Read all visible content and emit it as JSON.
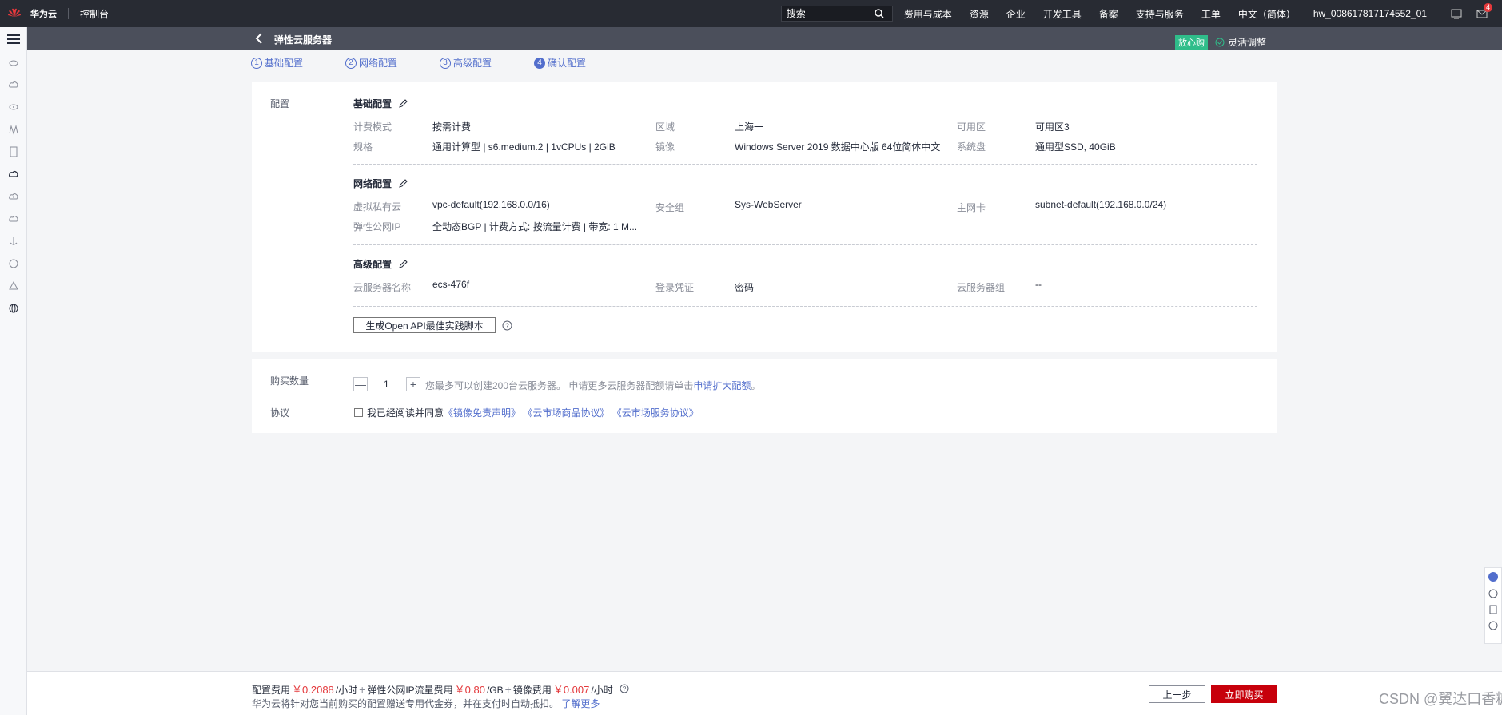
{
  "topbar": {
    "brand": "华为云",
    "console": "控制台",
    "search_placeholder": "搜索",
    "nav": [
      "费用与成本",
      "资源",
      "企业",
      "开发工具",
      "备案",
      "支持与服务",
      "工单",
      "中文（简体）"
    ],
    "username": "hw_008617817174552_01",
    "notice_count": "4"
  },
  "header": {
    "title": "弹性云服务器",
    "anxin_badge": "放心购",
    "flex_adjust": "灵活调整"
  },
  "steps": [
    {
      "num": "1",
      "label": "基础配置"
    },
    {
      "num": "2",
      "label": "网络配置"
    },
    {
      "num": "3",
      "label": "高级配置"
    },
    {
      "num": "4",
      "label": "确认配置"
    }
  ],
  "config": {
    "label": "配置",
    "basic": {
      "title": "基础配置",
      "billing_k": "计费模式",
      "billing_v": "按需计费",
      "region_k": "区域",
      "region_v": "上海一",
      "az_k": "可用区",
      "az_v": "可用区3",
      "spec_k": "规格",
      "spec_v": "通用计算型 | s6.medium.2 | 1vCPUs | 2GiB",
      "image_k": "镜像",
      "image_v": "Windows Server 2019 数据中心版 64位简体中文",
      "disk_k": "系统盘",
      "disk_v": "通用型SSD, 40GiB"
    },
    "network": {
      "title": "网络配置",
      "vpc_k": "虚拟私有云",
      "vpc_v": "vpc-default(192.168.0.0/16)",
      "sg_k": "安全组",
      "sg_v": "Sys-WebServer",
      "nic_k": "主网卡",
      "nic_v": "subnet-default(192.168.0.0/24)",
      "eip_k": "弹性公网IP",
      "eip_v": "全动态BGP | 计费方式: 按流量计费 | 带宽: 1 M..."
    },
    "advanced": {
      "title": "高级配置",
      "name_k": "云服务器名称",
      "name_v": "ecs-476f",
      "login_k": "登录凭证",
      "login_v": "密码",
      "group_k": "云服务器组",
      "group_v": "--"
    },
    "api_button": "生成Open API最佳实践脚本"
  },
  "purchase": {
    "qty_label": "购买数量",
    "qty_value": "1",
    "qty_hint": "您最多可以创建200台云服务器。 申请更多云服务器配额请单击",
    "qty_link": "申请扩大配额",
    "qty_end": "。",
    "agreement_label": "协议",
    "agreement_text": "我已经阅读并同意",
    "agreement_links": [
      "《镜像免责声明》",
      "《云市场商品协议》",
      "《云市场服务协议》"
    ]
  },
  "footer": {
    "config_fee_label": "配置费用",
    "config_fee": "￥0.2088",
    "config_fee_unit": "/小时",
    "eip_fee_label": "弹性公网IP流量费用",
    "eip_fee": "￥0.80",
    "eip_fee_unit": "/GB",
    "image_fee_label": "镜像费用",
    "image_fee": "￥0.007",
    "image_fee_unit": "/小时",
    "note": "华为云将针对您当前购买的配置赠送专用代金券，并在支付时自动抵扣。",
    "note_link": "了解更多",
    "prev_button": "上一步",
    "buy_button": "立即购买",
    "watermark": "CSDN @翼达口香糖"
  },
  "colors": {
    "accent": "#526ecc",
    "price": "#e4393c",
    "buy": "#c7000b",
    "topbar": "#282b33",
    "header": "#4b4f5b"
  }
}
